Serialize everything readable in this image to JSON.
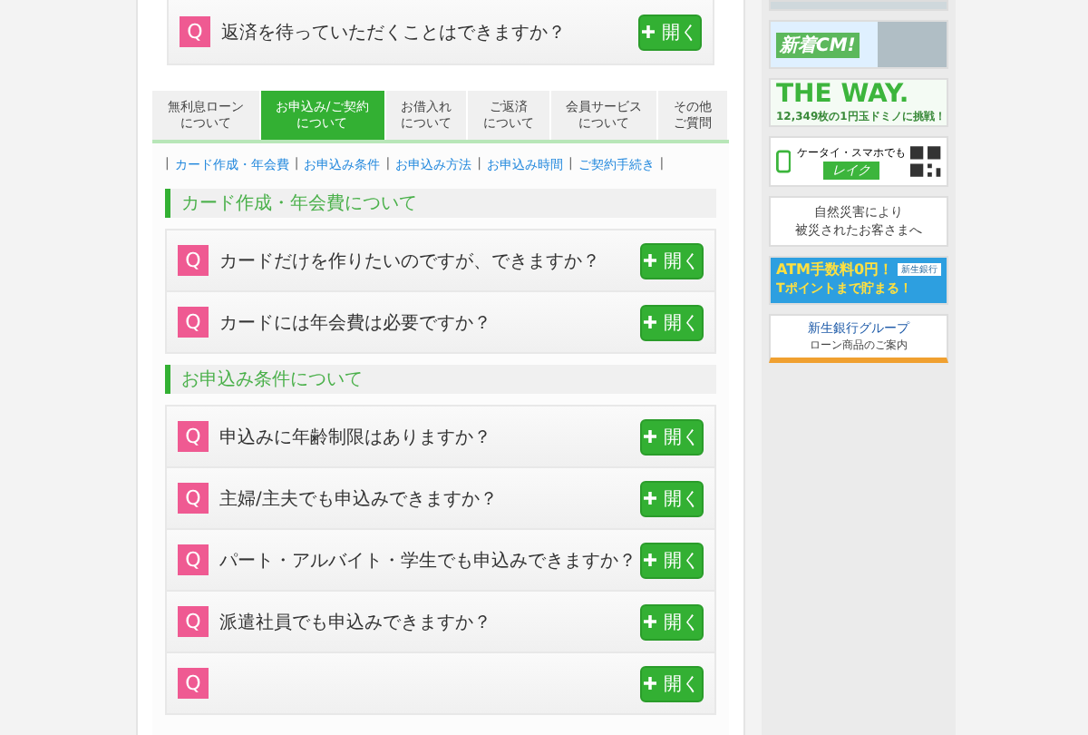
{
  "top_item": {
    "badge": "Q",
    "question": "返済を待っていただくことはできますか？",
    "button": "開く"
  },
  "tabs": [
    {
      "lines": [
        "無利息ローン",
        "について"
      ],
      "selected": false
    },
    {
      "lines": [
        "お申込み/ご契約",
        "について"
      ],
      "selected": true
    },
    {
      "lines": [
        "お借入れ",
        "について"
      ],
      "selected": false
    },
    {
      "lines": [
        "ご返済",
        "について"
      ],
      "selected": false
    },
    {
      "lines": [
        "会員サービス",
        "について"
      ],
      "selected": false
    },
    {
      "lines": [
        "その他",
        "ご質問"
      ],
      "selected": false
    }
  ],
  "anchor_links": [
    {
      "kind": "sep",
      "text": "|"
    },
    {
      "kind": "link",
      "text": "カード作成・年会費"
    },
    {
      "kind": "sep",
      "text": "|"
    },
    {
      "kind": "link",
      "text": "お申込み条件"
    },
    {
      "kind": "sep",
      "text": "|"
    },
    {
      "kind": "link",
      "text": "お申込み方法"
    },
    {
      "kind": "sep",
      "text": "|"
    },
    {
      "kind": "link",
      "text": "お申込み時間"
    },
    {
      "kind": "sep",
      "text": "|"
    },
    {
      "kind": "link",
      "text": "ご契約手続き"
    },
    {
      "kind": "sep",
      "text": "|"
    }
  ],
  "sections": [
    {
      "heading": "カード作成・年会費について",
      "items": [
        {
          "badge": "Q",
          "question": "カードだけを作りたいのですが、できますか？",
          "button": "開く"
        },
        {
          "badge": "Q",
          "question": "カードには年会費は必要ですか？",
          "button": "開く"
        }
      ]
    },
    {
      "heading": "お申込み条件について",
      "items": [
        {
          "badge": "Q",
          "question": "申込みに年齢制限はありますか？",
          "button": "開く"
        },
        {
          "badge": "Q",
          "question": "主婦/主夫でも申込みできますか？",
          "button": "開く"
        },
        {
          "badge": "Q",
          "question": "パート・アルバイト・学生でも申込みできますか？",
          "button": "開く"
        },
        {
          "badge": "Q",
          "question": "派遣社員でも申込みできますか？",
          "button": "開く"
        },
        {
          "badge": "Q",
          "button": "開く"
        }
      ]
    }
  ],
  "sidebar": {
    "banners": [
      {
        "kind": "photo"
      },
      {
        "kind": "cm",
        "text": "新着CM!"
      },
      {
        "kind": "way",
        "title": "THE WAY.",
        "subtitle": "12,349枚の1円玉ドミノに挑戦！"
      },
      {
        "kind": "mobile",
        "text": "ケータイ・スマホでも",
        "brand": "レイク"
      },
      {
        "kind": "notice",
        "lines": [
          "自然災害により",
          "被災されたお客さまへ"
        ]
      },
      {
        "kind": "atm",
        "title": "ATM手数料0円！",
        "subtitle": "Tポイントまで貯まる！",
        "brand": "新生銀行"
      },
      {
        "kind": "group",
        "title": "新生銀行グループ",
        "subtitle": "ローン商品のご案内"
      }
    ]
  }
}
